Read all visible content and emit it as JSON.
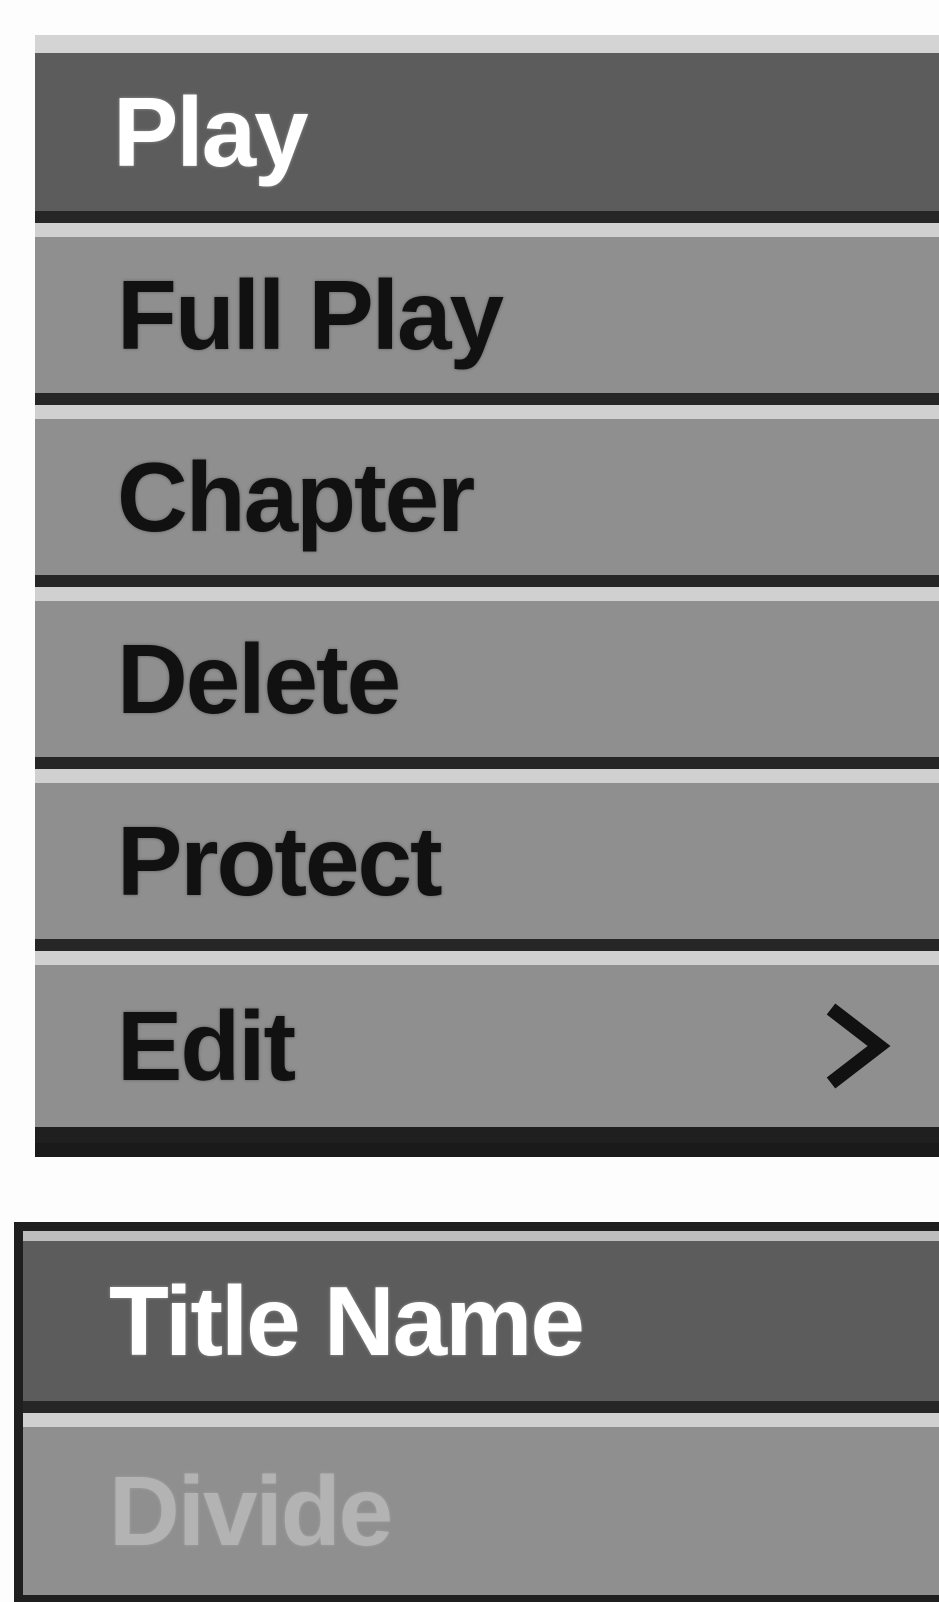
{
  "main_menu": {
    "items": [
      {
        "label": "Play"
      },
      {
        "label": "Full Play"
      },
      {
        "label": "Chapter"
      },
      {
        "label": "Delete"
      },
      {
        "label": "Protect"
      },
      {
        "label": "Edit",
        "icon": "chevron-right-icon"
      }
    ],
    "selected_index": 0
  },
  "sub_menu": {
    "items": [
      {
        "label": "Title Name"
      },
      {
        "label": "Divide",
        "disabled": true
      }
    ],
    "selected_index": 0
  },
  "colors": {
    "background": "#fdfdfd",
    "item": "#8f8f8f",
    "item_selected": "#5c5c5c",
    "separator_dark": "#262626",
    "separator_light": "#d0d0d0",
    "text": "#111111",
    "text_selected": "#ffffff",
    "text_disabled": "#b3b3b3"
  }
}
